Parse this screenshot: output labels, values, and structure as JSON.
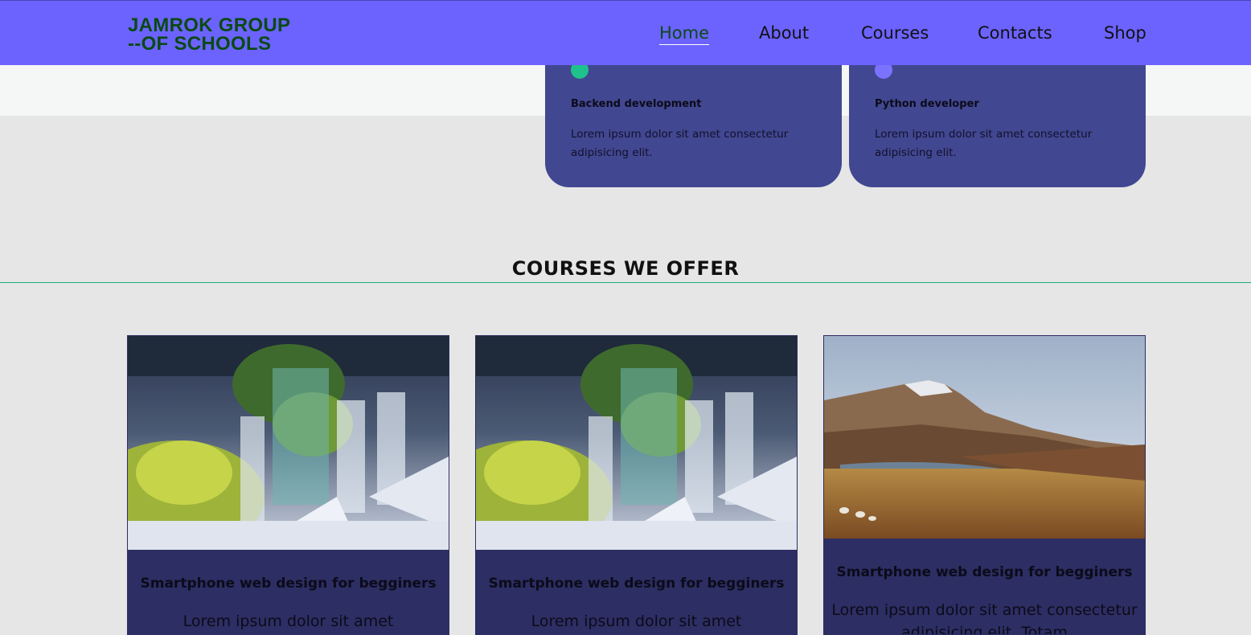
{
  "brand": {
    "line1": "JAMROK GROUP",
    "line2": "--OF SCHOOLS"
  },
  "nav": {
    "items": [
      {
        "label": "Home",
        "active": true
      },
      {
        "label": "About"
      },
      {
        "label": "Courses"
      },
      {
        "label": "Contacts"
      },
      {
        "label": "Shop"
      }
    ]
  },
  "features": [
    {
      "title": "Backend development",
      "text": "Lorem ipsum dolor sit amet consectetur adipisicing elit.",
      "dot_color": "#1fc28c"
    },
    {
      "title": "Python developer",
      "text": "Lorem ipsum dolor sit amet consectetur adipisicing elit.",
      "dot_color": "#7b72ff"
    }
  ],
  "courses_section": {
    "title": "COURSES WE OFFER"
  },
  "courses": [
    {
      "image": "table-setting-photo",
      "title": "Smartphone web design for begginers",
      "text": "Lorem ipsum dolor sit amet"
    },
    {
      "image": "table-setting-photo",
      "title": "Smartphone web design for begginers",
      "text": "Lorem ipsum dolor sit amet"
    },
    {
      "image": "mountain-landscape-photo",
      "title": "Smartphone web design for begginers",
      "text": "Lorem ipsum dolor sit amet consectetur adipisicing elit. Totam"
    }
  ],
  "colors": {
    "navbar": "#6c63ff",
    "brand_text": "#0a4a14",
    "feature_card": "#424791",
    "course_card": "#2d2e63",
    "section_line": "#1aaa7a"
  }
}
